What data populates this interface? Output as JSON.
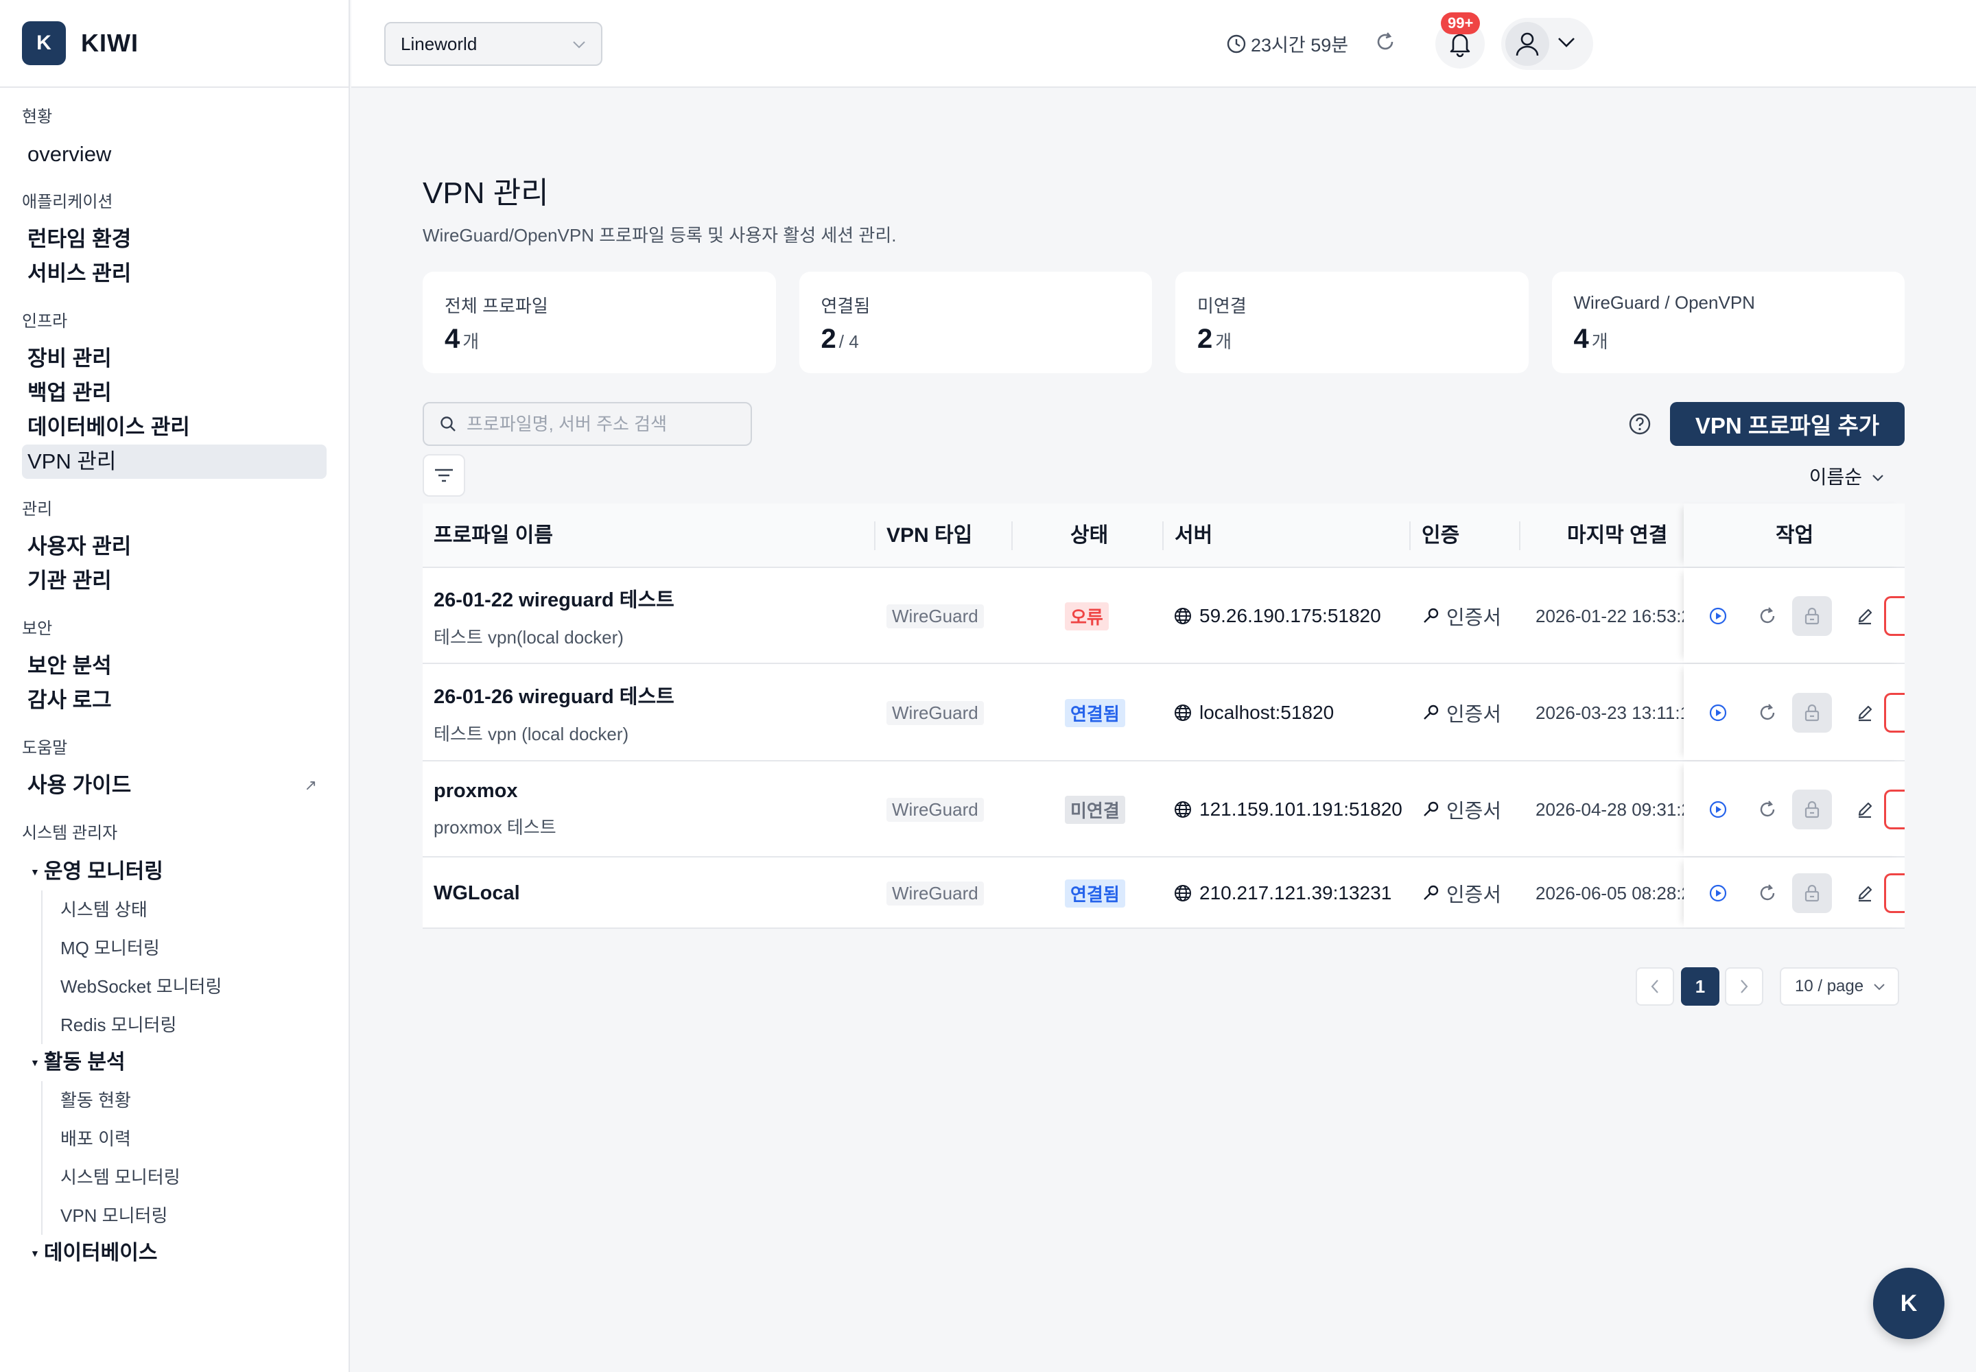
{
  "brand": {
    "badge": "K",
    "name": "KIWI"
  },
  "sidebar": {
    "sections": [
      {
        "heading": "현황",
        "items": [
          "overview"
        ]
      },
      {
        "heading": "애플리케이션",
        "items": [
          "런타임 환경",
          "서비스 관리"
        ]
      },
      {
        "heading": "인프라",
        "items": [
          "장비 관리",
          "백업 관리",
          "데이터베이스 관리",
          "VPN 관리"
        ],
        "active": "VPN 관리"
      },
      {
        "heading": "관리",
        "items": [
          "사용자 관리",
          "기관 관리"
        ]
      },
      {
        "heading": "보안",
        "items": [
          "보안 분석",
          "감사 로그"
        ]
      },
      {
        "heading": "도움말",
        "items": [
          "사용 가이드"
        ],
        "external": "↗"
      }
    ],
    "admin": {
      "heading": "시스템 관리자",
      "groups": [
        {
          "label": "운영 모니터링",
          "items": [
            "시스템 상태",
            "MQ 모니터링",
            "WebSocket 모니터링",
            "Redis 모니터링"
          ]
        },
        {
          "label": "활동 분석",
          "items": [
            "활동 현황",
            "배포 이력",
            "시스템 모니터링",
            "VPN 모니터링"
          ]
        },
        {
          "label": "데이터베이스",
          "items": []
        }
      ]
    }
  },
  "header": {
    "org": "Lineworld",
    "session": "23시간 59분",
    "notifications": "99+"
  },
  "page": {
    "title": "VPN 관리",
    "subtitle": "WireGuard/OpenVPN 프로파일 등록 및 사용자 활성 세션 관리."
  },
  "stats": [
    {
      "label": "전체 프로파일",
      "value": "4",
      "unit": "개"
    },
    {
      "label": "연결됨",
      "value": "2",
      "unit": "/ 4"
    },
    {
      "label": "미연결",
      "value": "2",
      "unit": "개"
    },
    {
      "label": "WireGuard / OpenVPN",
      "value": "4",
      "unit": "개"
    }
  ],
  "toolbar": {
    "search_placeholder": "프로파일명, 서버 주소 검색",
    "add_label": "VPN 프로파일 추가",
    "sort_label": "이름순"
  },
  "table": {
    "columns": [
      "프로파일 이름",
      "VPN 타입",
      "상태",
      "서버",
      "인증",
      "마지막 연결",
      "작업"
    ],
    "rows": [
      {
        "name": "26-01-22 wireguard 테스트",
        "desc": "테스트 vpn(local docker)",
        "type": "WireGuard",
        "status": "오류",
        "status_kind": "err",
        "server": "59.26.190.175:51820",
        "auth": "인증서",
        "last": "2026-01-22 16:53:2"
      },
      {
        "name": "26-01-26 wireguard 테스트",
        "desc": "테스트 vpn (local docker)",
        "type": "WireGuard",
        "status": "연결됨",
        "status_kind": "ok",
        "server": "localhost:51820",
        "auth": "인증서",
        "last": "2026-03-23 13:11:1"
      },
      {
        "name": "proxmox",
        "desc": "proxmox 테스트",
        "type": "WireGuard",
        "status": "미연결",
        "status_kind": "off",
        "server": "121.159.101.191:51820",
        "auth": "인증서",
        "last": "2026-04-28 09:31:2"
      },
      {
        "name": "WGLocal",
        "desc": "",
        "type": "WireGuard",
        "status": "연결됨",
        "status_kind": "ok",
        "server": "210.217.121.39:13231",
        "auth": "인증서",
        "last": "2026-06-05 08:28:2"
      }
    ]
  },
  "pagination": {
    "current": "1",
    "page_size": "10 / page"
  },
  "fab": "K",
  "colors": {
    "primary": "#1e3a5f",
    "danger": "#ef4444",
    "info": "#2563eb"
  }
}
